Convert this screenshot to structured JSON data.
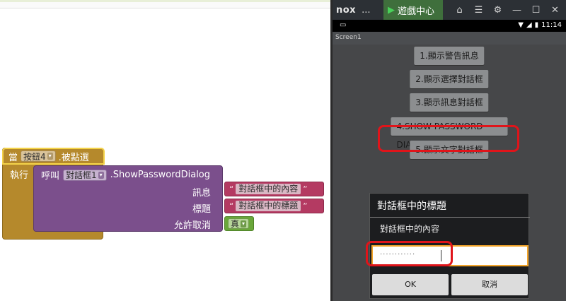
{
  "blocks": {
    "event": {
      "when_label": "當",
      "component": "按鈕4",
      "event_name": ".被點選",
      "do_label": "執行"
    },
    "call": {
      "call_label": "呼叫",
      "component": "對話框1",
      "method": ".ShowPasswordDialog",
      "args": [
        {
          "label": "訊息",
          "value": "對話框中的內容"
        },
        {
          "label": "標題",
          "value": "對話框中的標題"
        },
        {
          "label": "允許取消",
          "value": "真"
        }
      ]
    },
    "dropdown_arrow": "▾",
    "quote_open": "“",
    "quote_close": "”"
  },
  "emulator": {
    "brand": "nox",
    "brand_dots": "...",
    "game_tab": "遊戲中心",
    "statusbar_time": "11:14",
    "screen_title": "Screen1",
    "buttons": [
      "1.顯示警告訊息",
      "2.顯示選擇對話框",
      "3.顯示訊息對話框",
      "4.SHOW PASSWORD DIALOG",
      "5.顯示文字對話框"
    ],
    "dialog": {
      "title": "對話框中的標題",
      "message": "對話框中的內容",
      "password_mask": "············",
      "ok": "OK",
      "cancel": "取消"
    }
  },
  "colors": {
    "event_block": "#b5892c",
    "call_block": "#7b4f8c",
    "text_block": "#b43a62",
    "logic_block": "#6aa73a",
    "highlight": "#e0141a"
  }
}
